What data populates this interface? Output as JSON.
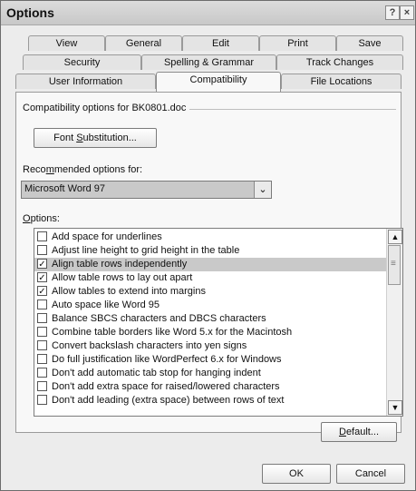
{
  "window": {
    "title": "Options"
  },
  "titlebar": {
    "help_label": "?",
    "close_label": "×"
  },
  "tabs": {
    "row1": [
      "View",
      "General",
      "Edit",
      "Print",
      "Save"
    ],
    "row2": [
      "Security",
      "Spelling & Grammar",
      "Track Changes"
    ],
    "row3": [
      "User Information",
      "Compatibility",
      "File Locations"
    ],
    "active": "Compatibility"
  },
  "compat": {
    "heading": "Compatibility options for BK0801.doc",
    "font_sub_pre": "Font ",
    "font_sub_u": "S",
    "font_sub_post": "ubstitution...",
    "recommended_pre": "Reco",
    "recommended_u": "m",
    "recommended_post": "mended options for:",
    "recommended_value": "Microsoft Word 97",
    "options_u": "O",
    "options_post": "ptions:"
  },
  "options": [
    {
      "label": "Add space for underlines",
      "checked": false
    },
    {
      "label": "Adjust line height to grid height in the table",
      "checked": false
    },
    {
      "label": "Align table rows independently",
      "checked": true
    },
    {
      "label": "Allow table rows to lay out apart",
      "checked": true
    },
    {
      "label": "Allow tables to extend into margins",
      "checked": true
    },
    {
      "label": "Auto space like Word 95",
      "checked": false
    },
    {
      "label": "Balance SBCS characters and DBCS characters",
      "checked": false
    },
    {
      "label": "Combine table borders like Word 5.x for the Macintosh",
      "checked": false
    },
    {
      "label": "Convert backslash characters into yen signs",
      "checked": false
    },
    {
      "label": "Do full justification like WordPerfect 6.x for Windows",
      "checked": false
    },
    {
      "label": "Don't add automatic tab stop for hanging indent",
      "checked": false
    },
    {
      "label": "Don't add extra space for raised/lowered characters",
      "checked": false
    },
    {
      "label": "Don't add leading (extra space) between rows of text",
      "checked": false
    }
  ],
  "check_glyph": "✓",
  "buttons": {
    "default_u": "D",
    "default_post": "efault...",
    "ok": "OK",
    "cancel": "Cancel"
  },
  "icons": {
    "scroll_up": "▲",
    "scroll_down": "▼",
    "dropdown": "⌄",
    "grip": "≡"
  }
}
